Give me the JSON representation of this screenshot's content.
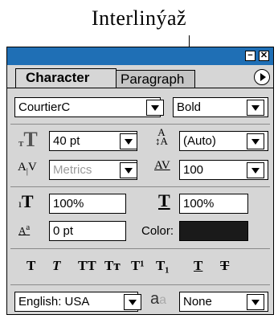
{
  "annotation": {
    "text": "Interlinýaž"
  },
  "window": {
    "minimize_glyph": "−",
    "close_glyph": "✕"
  },
  "tabs": [
    {
      "label": "Character",
      "active": true
    },
    {
      "label": "Paragraph",
      "active": false
    }
  ],
  "font": {
    "family": "CourtierC",
    "style": "Bold"
  },
  "size": {
    "value": "40 pt"
  },
  "leading": {
    "value": "(Auto)"
  },
  "kerning": {
    "value": "Metrics"
  },
  "tracking": {
    "value": "100"
  },
  "vertical_scale": {
    "value": "100%"
  },
  "horizontal_scale": {
    "value": "100%"
  },
  "baseline_shift": {
    "value": "0 pt"
  },
  "color": {
    "label": "Color:",
    "swatch": "#1a1a1a"
  },
  "style_buttons": [
    {
      "name": "faux-bold",
      "glyph": "T"
    },
    {
      "name": "faux-italic",
      "glyph": "T"
    },
    {
      "name": "all-caps",
      "glyph": "TT"
    },
    {
      "name": "small-caps",
      "glyph": "Tт"
    },
    {
      "name": "superscript",
      "glyph": "T¹"
    },
    {
      "name": "subscript",
      "glyph": "T₁"
    },
    {
      "name": "underline",
      "glyph": "T"
    },
    {
      "name": "strikethrough",
      "glyph": "T"
    }
  ],
  "language": {
    "value": "English: USA"
  },
  "antialias": {
    "icon_text": "aa",
    "value": "None"
  },
  "colors": {
    "titlebar": "#1f6fb5",
    "panel": "#d6d6d6"
  }
}
